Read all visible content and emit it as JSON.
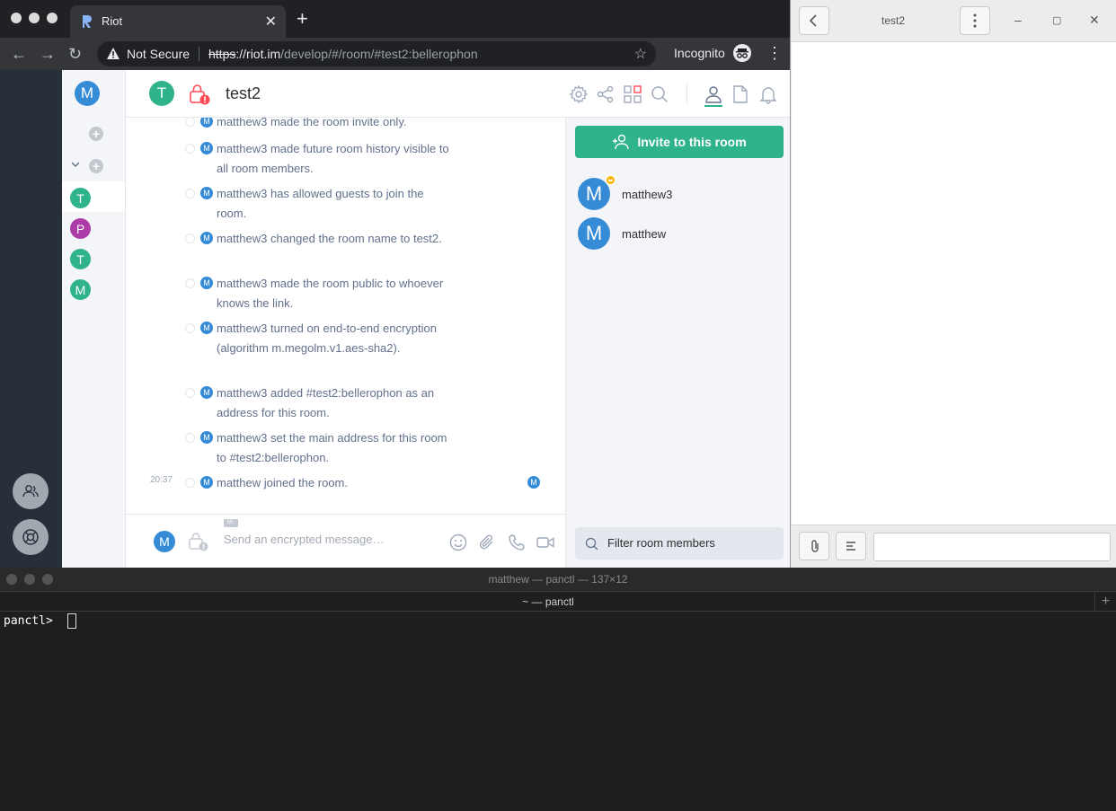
{
  "browser": {
    "tab_title": "Riot",
    "url_security": "Not Secure",
    "url_scheme": "https",
    "url_host": "://riot.im",
    "url_path": "/develop/#/room/#test2:bellerophon",
    "incognito_label": "Incognito"
  },
  "riot": {
    "user_avatar_letter": "M",
    "room_list": [
      {
        "letter": "T",
        "color": "#2fb38b"
      },
      {
        "letter": "P",
        "color": "#ac3ba8"
      },
      {
        "letter": "T",
        "color": "#2fb38b"
      },
      {
        "letter": "M",
        "color": "#2fb38b"
      }
    ],
    "room": {
      "avatar_letter": "T",
      "name": "test2"
    },
    "events": [
      {
        "text": "matthew3 made the room invite only.",
        "time": ""
      },
      {
        "text": "matthew3 made future room history visible to all room members.",
        "time": ""
      },
      {
        "text": "matthew3 has allowed guests to join the room.",
        "time": ""
      },
      {
        "text": "matthew3 changed the room name to test2.",
        "time": ""
      },
      {
        "text": "matthew3 made the room public to whoever knows the link.",
        "time": ""
      },
      {
        "text": "matthew3 turned on end-to-end encryption (algorithm m.megolm.v1.aes-sha2).",
        "time": ""
      },
      {
        "text": "matthew3 added #test2:bellerophon as an address for this room.",
        "time": ""
      },
      {
        "text": "matthew3 set the main address for this room to #test2:bellerophon.",
        "time": ""
      },
      {
        "text": "matthew joined the room.",
        "time": "20:37"
      }
    ],
    "event_avatar_letter": "M",
    "composer": {
      "avatar_letter": "M",
      "markdown_badge": "M↓",
      "placeholder": "Send an encrypted message…"
    },
    "right_panel": {
      "invite_label": "Invite to this room",
      "members": [
        {
          "name": "matthew3",
          "letter": "M",
          "is_admin": true
        },
        {
          "name": "matthew",
          "letter": "M",
          "is_admin": false
        }
      ],
      "filter_placeholder": "Filter room members"
    },
    "colors": {
      "accent": "#2fb38b",
      "avatar_blue": "#368bd6",
      "alert_red": "#ff4b55"
    }
  },
  "side_window": {
    "title": "test2"
  },
  "terminal": {
    "window_title": "matthew — panctl — 137×12",
    "tab_title": "~ — panctl",
    "prompt": "panctl> "
  }
}
